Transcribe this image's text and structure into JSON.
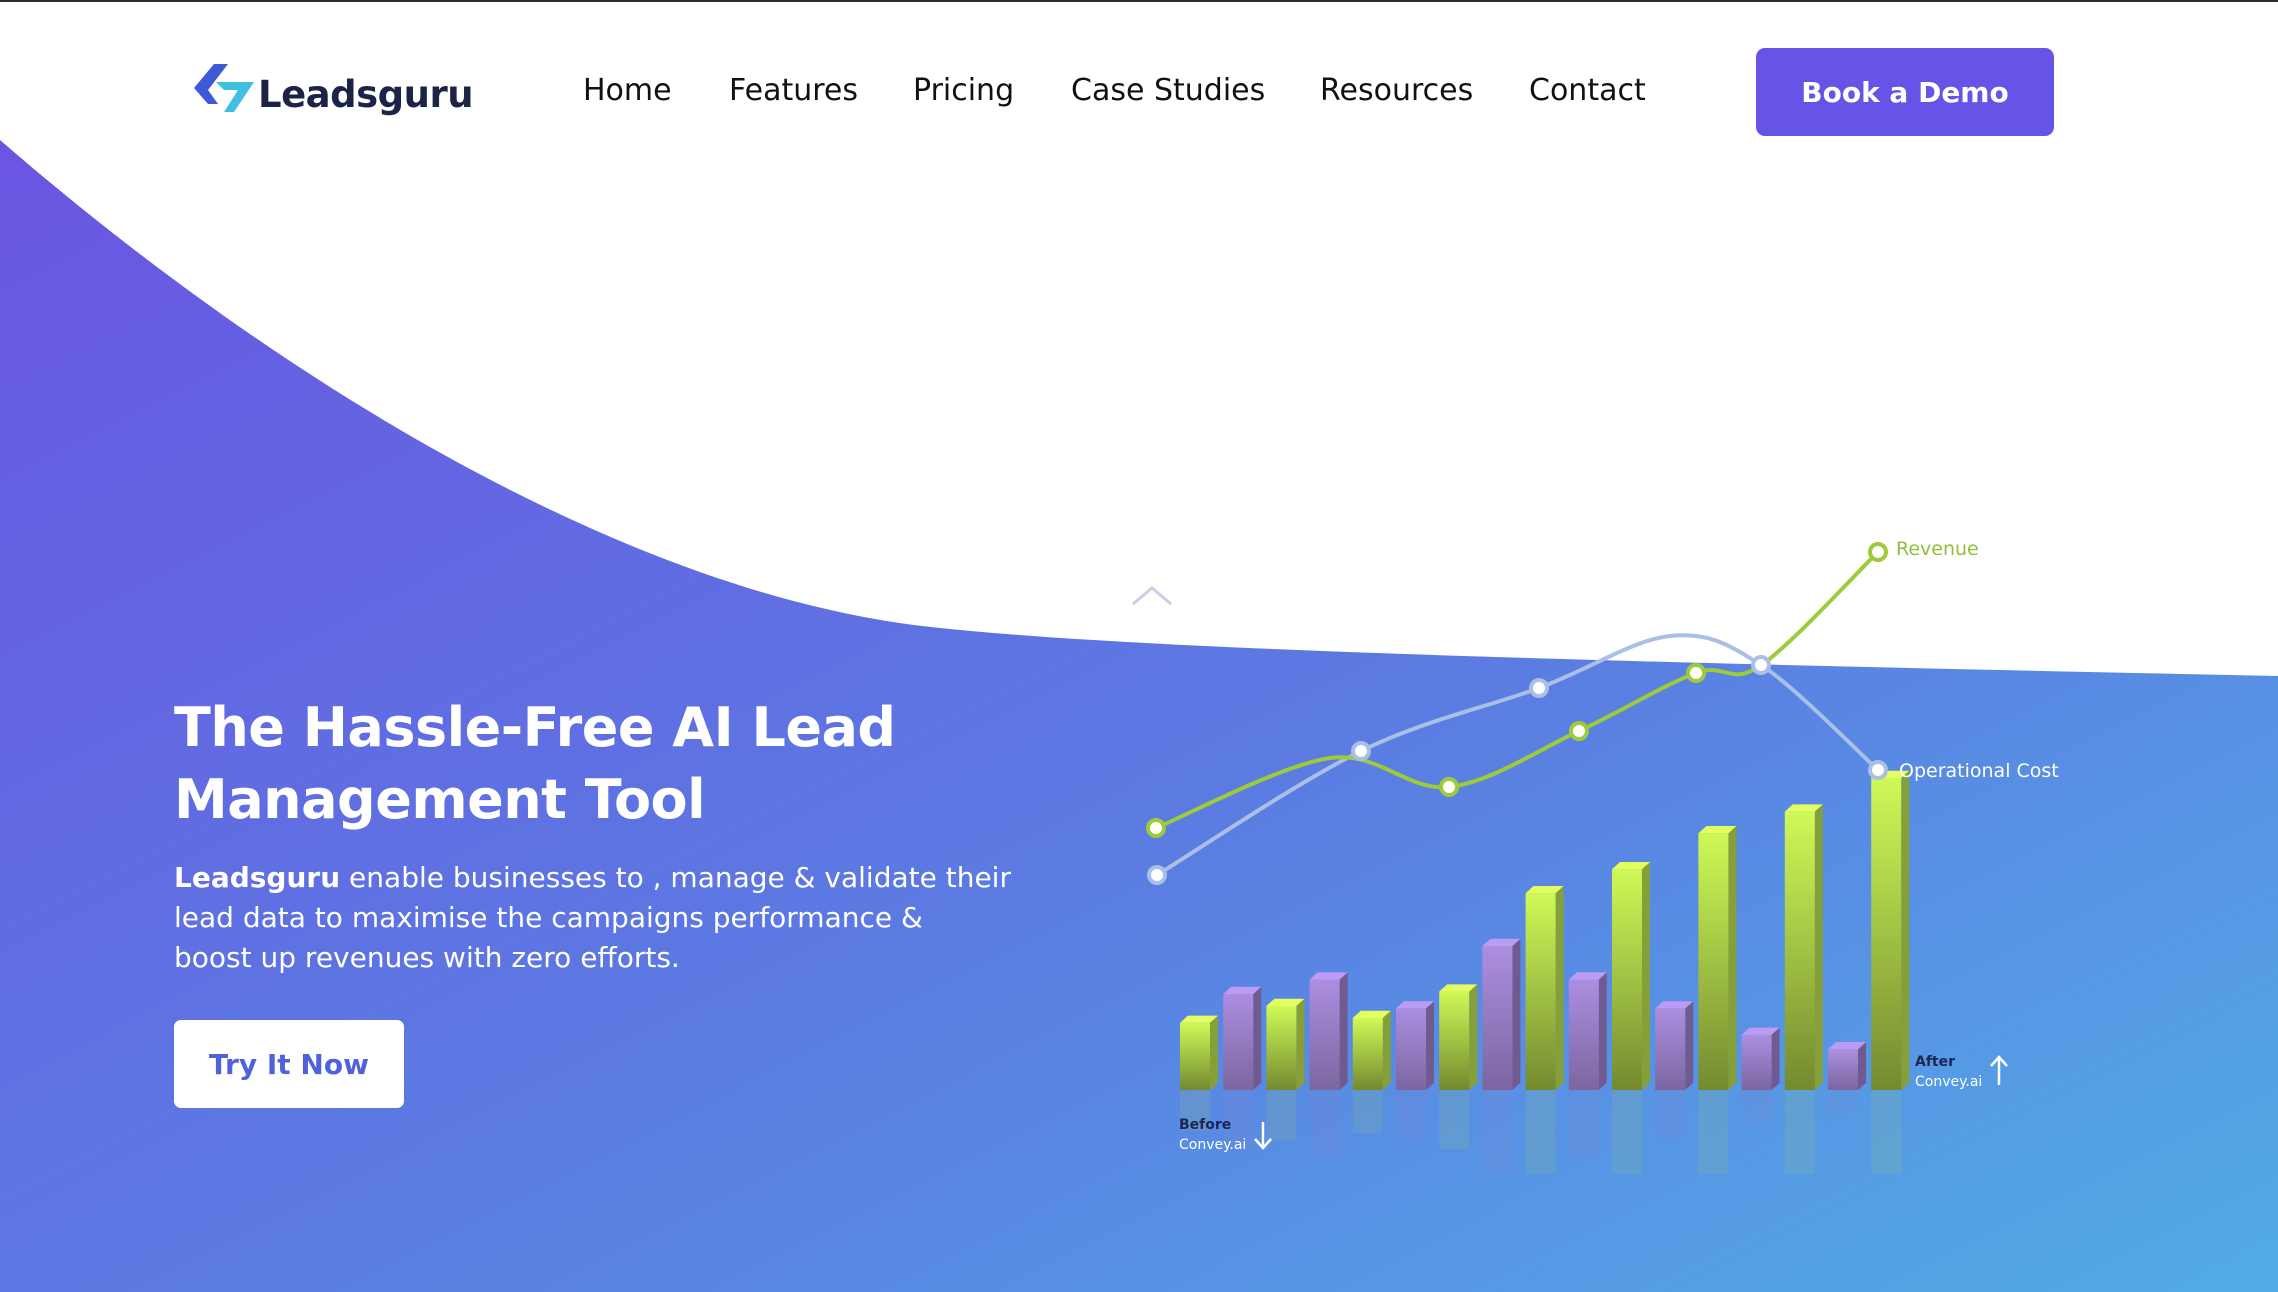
{
  "header": {
    "logo_text": "Leadsguru",
    "nav": [
      {
        "label": "Home"
      },
      {
        "label": "Features"
      },
      {
        "label": "Pricing"
      },
      {
        "label": "Case Studies"
      },
      {
        "label": "Resources"
      },
      {
        "label": "Contact"
      }
    ],
    "cta_label": "Book a Demo"
  },
  "hero": {
    "title_line1": "The Hassle-Free AI Lead",
    "title_line2": "Management Tool",
    "desc_brand": "Leadsguru",
    "desc_line1": " enable businesses to , manage & validate their",
    "desc_line2": "lead data to maximise the campaigns performance &",
    "desc_line3": "boost up revenues with zero efforts.",
    "cta_label": "Try It Now"
  },
  "colors": {
    "accent": "#6654e6",
    "hero_gradient_start": "#6a57e3",
    "hero_gradient_end": "#52a9e6",
    "revenue_line": "#9dcb3a",
    "cost_line": "#a9bfe6",
    "green_bar": "#b9de4e",
    "purple_bar": "#9a7fc8"
  },
  "illustration": {
    "revenue_label": "Revenue",
    "cost_label": "Operational Cost",
    "before_label_1": "Before",
    "before_label_2": "Convey.ai",
    "after_label_1": "After",
    "after_label_2": "Convey.ai",
    "bars": [
      {
        "kind": "green",
        "level": 0.28
      },
      {
        "kind": "purple",
        "level": 0.4
      },
      {
        "kind": "green",
        "level": 0.35
      },
      {
        "kind": "purple",
        "level": 0.46
      },
      {
        "kind": "green",
        "level": 0.3
      },
      {
        "kind": "purple",
        "level": 0.34
      },
      {
        "kind": "green",
        "level": 0.41
      },
      {
        "kind": "purple",
        "level": 0.6
      },
      {
        "kind": "green",
        "level": 0.82
      },
      {
        "kind": "purple",
        "level": 0.46
      },
      {
        "kind": "green",
        "level": 0.92
      },
      {
        "kind": "purple",
        "level": 0.34
      },
      {
        "kind": "green",
        "level": 1.07
      },
      {
        "kind": "purple",
        "level": 0.23
      },
      {
        "kind": "green",
        "level": 1.16
      },
      {
        "kind": "purple",
        "level": 0.17
      },
      {
        "kind": "green",
        "level": 1.3
      }
    ],
    "revenue_trend": [
      0.3,
      0.46,
      0.36,
      0.58,
      0.8,
      1.3
    ],
    "cost_trend": [
      0.08,
      0.55,
      0.86,
      0.95,
      0.4
    ]
  }
}
